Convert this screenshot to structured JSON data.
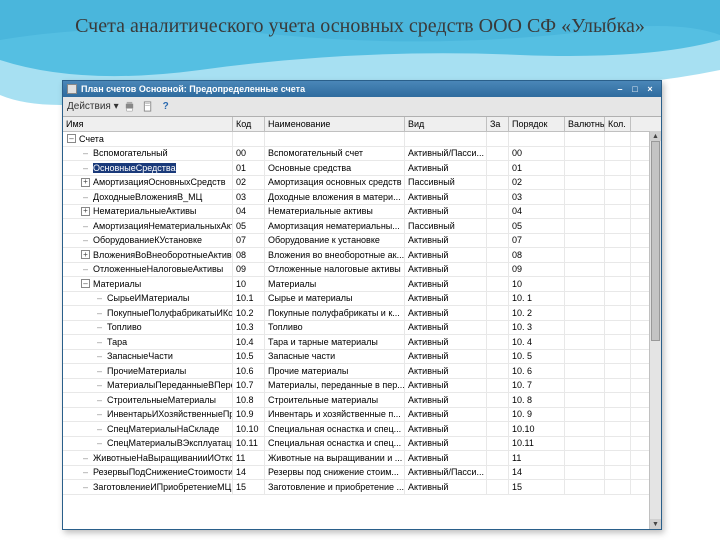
{
  "slide": {
    "title": "Счета аналитического учета основных средств ООО СФ «Улыбка»"
  },
  "window": {
    "title": "План счетов Основной: Предопределенные счета",
    "toolbar": {
      "actions": "Действия ▾"
    },
    "columns": {
      "name": "Имя",
      "code": "Код",
      "desc": "Наименование",
      "kind": "Вид",
      "za": "За",
      "order": "Порядок",
      "valut": "Валютный",
      "qty": "Кол."
    },
    "rows": [
      {
        "level": 0,
        "icon": "minus",
        "name": "Счета",
        "code": "",
        "desc": "",
        "kind": "",
        "order": ""
      },
      {
        "level": 1,
        "icon": "leaf",
        "name": "Вспомогательный",
        "code": "00",
        "desc": "Вспомогательный счет",
        "kind": "Активный/Пасси...",
        "order": "00"
      },
      {
        "level": 1,
        "icon": "leaf",
        "name": "ОсновныеСредства",
        "code": "01",
        "desc": "Основные средства",
        "kind": "Активный",
        "order": "01",
        "selected": true
      },
      {
        "level": 1,
        "icon": "plus",
        "name": "АмортизацияОсновныхСредств",
        "code": "02",
        "desc": "Амортизация основных средств",
        "kind": "Пассивный",
        "order": "02"
      },
      {
        "level": 1,
        "icon": "leaf",
        "name": "ДоходныеВложенияВ_МЦ",
        "code": "03",
        "desc": "Доходные вложения в матери...",
        "kind": "Активный",
        "order": "03"
      },
      {
        "level": 1,
        "icon": "plus",
        "name": "НематериальныеАктивы",
        "code": "04",
        "desc": "Нематериальные активы",
        "kind": "Активный",
        "order": "04"
      },
      {
        "level": 1,
        "icon": "leaf",
        "name": "АмортизацияНематериальныхАктивов",
        "code": "05",
        "desc": "Амортизация нематериальны...",
        "kind": "Пассивный",
        "order": "05"
      },
      {
        "level": 1,
        "icon": "leaf",
        "name": "ОборудованиеКУстановке",
        "code": "07",
        "desc": "Оборудование к установке",
        "kind": "Активный",
        "order": "07"
      },
      {
        "level": 1,
        "icon": "plus",
        "name": "ВложенияВоВнеоборотныеАктивы",
        "code": "08",
        "desc": "Вложения во внеоборотные ак...",
        "kind": "Активный",
        "order": "08"
      },
      {
        "level": 1,
        "icon": "leaf",
        "name": "ОтложенныеНалоговыеАктивы",
        "code": "09",
        "desc": "Отложенные налоговые активы",
        "kind": "Активный",
        "order": "09"
      },
      {
        "level": 1,
        "icon": "minus",
        "name": "Материалы",
        "code": "10",
        "desc": "Материалы",
        "kind": "Активный",
        "order": "10"
      },
      {
        "level": 2,
        "icon": "leaf",
        "name": "СырьеИМатериалы",
        "code": "10.1",
        "desc": "Сырье и материалы",
        "kind": "Активный",
        "order": "10. 1"
      },
      {
        "level": 2,
        "icon": "leaf",
        "name": "ПокупныеПолуфабрикатыИКомпл...",
        "code": "10.2",
        "desc": "Покупные полуфабрикаты и к...",
        "kind": "Активный",
        "order": "10. 2"
      },
      {
        "level": 2,
        "icon": "leaf",
        "name": "Топливо",
        "code": "10.3",
        "desc": "Топливо",
        "kind": "Активный",
        "order": "10. 3"
      },
      {
        "level": 2,
        "icon": "leaf",
        "name": "Тара",
        "code": "10.4",
        "desc": "Тара и тарные материалы",
        "kind": "Активный",
        "order": "10. 4"
      },
      {
        "level": 2,
        "icon": "leaf",
        "name": "ЗапасныеЧасти",
        "code": "10.5",
        "desc": "Запасные части",
        "kind": "Активный",
        "order": "10. 5"
      },
      {
        "level": 2,
        "icon": "leaf",
        "name": "ПрочиеМатериалы",
        "code": "10.6",
        "desc": "Прочие материалы",
        "kind": "Активный",
        "order": "10. 6"
      },
      {
        "level": 2,
        "icon": "leaf",
        "name": "МатериалыПереданныеВПерераб...",
        "code": "10.7",
        "desc": "Материалы, переданные в пер...",
        "kind": "Активный",
        "order": "10. 7"
      },
      {
        "level": 2,
        "icon": "leaf",
        "name": "СтроительныеМатериалы",
        "code": "10.8",
        "desc": "Строительные материалы",
        "kind": "Активный",
        "order": "10. 8"
      },
      {
        "level": 2,
        "icon": "leaf",
        "name": "ИнвентарьИХозяйственныеПрина...",
        "code": "10.9",
        "desc": "Инвентарь и хозяйственные п...",
        "kind": "Активный",
        "order": "10. 9"
      },
      {
        "level": 2,
        "icon": "leaf",
        "name": "СпецМатериалыНаСкладе",
        "code": "10.10",
        "desc": "Специальная оснастка и спец...",
        "kind": "Активный",
        "order": "10.10"
      },
      {
        "level": 2,
        "icon": "leaf",
        "name": "СпецМатериалыВЭксплуатации",
        "code": "10.11",
        "desc": "Специальная оснастка и спец...",
        "kind": "Активный",
        "order": "10.11"
      },
      {
        "level": 1,
        "icon": "leaf",
        "name": "ЖивотныеНаВыращиванииИОткорме",
        "code": "11",
        "desc": "Животные на выращивании и ...",
        "kind": "Активный",
        "order": "11"
      },
      {
        "level": 1,
        "icon": "leaf",
        "name": "РезервыПодСнижениеСтоимостиМЦ",
        "code": "14",
        "desc": "Резервы под снижение стоим...",
        "kind": "Активный/Пасси...",
        "order": "14"
      },
      {
        "level": 1,
        "icon": "leaf",
        "name": "ЗаготовлениеИПриобретениеМЦ",
        "code": "15",
        "desc": "Заготовление и приобретение ...",
        "kind": "Активный",
        "order": "15"
      }
    ]
  }
}
